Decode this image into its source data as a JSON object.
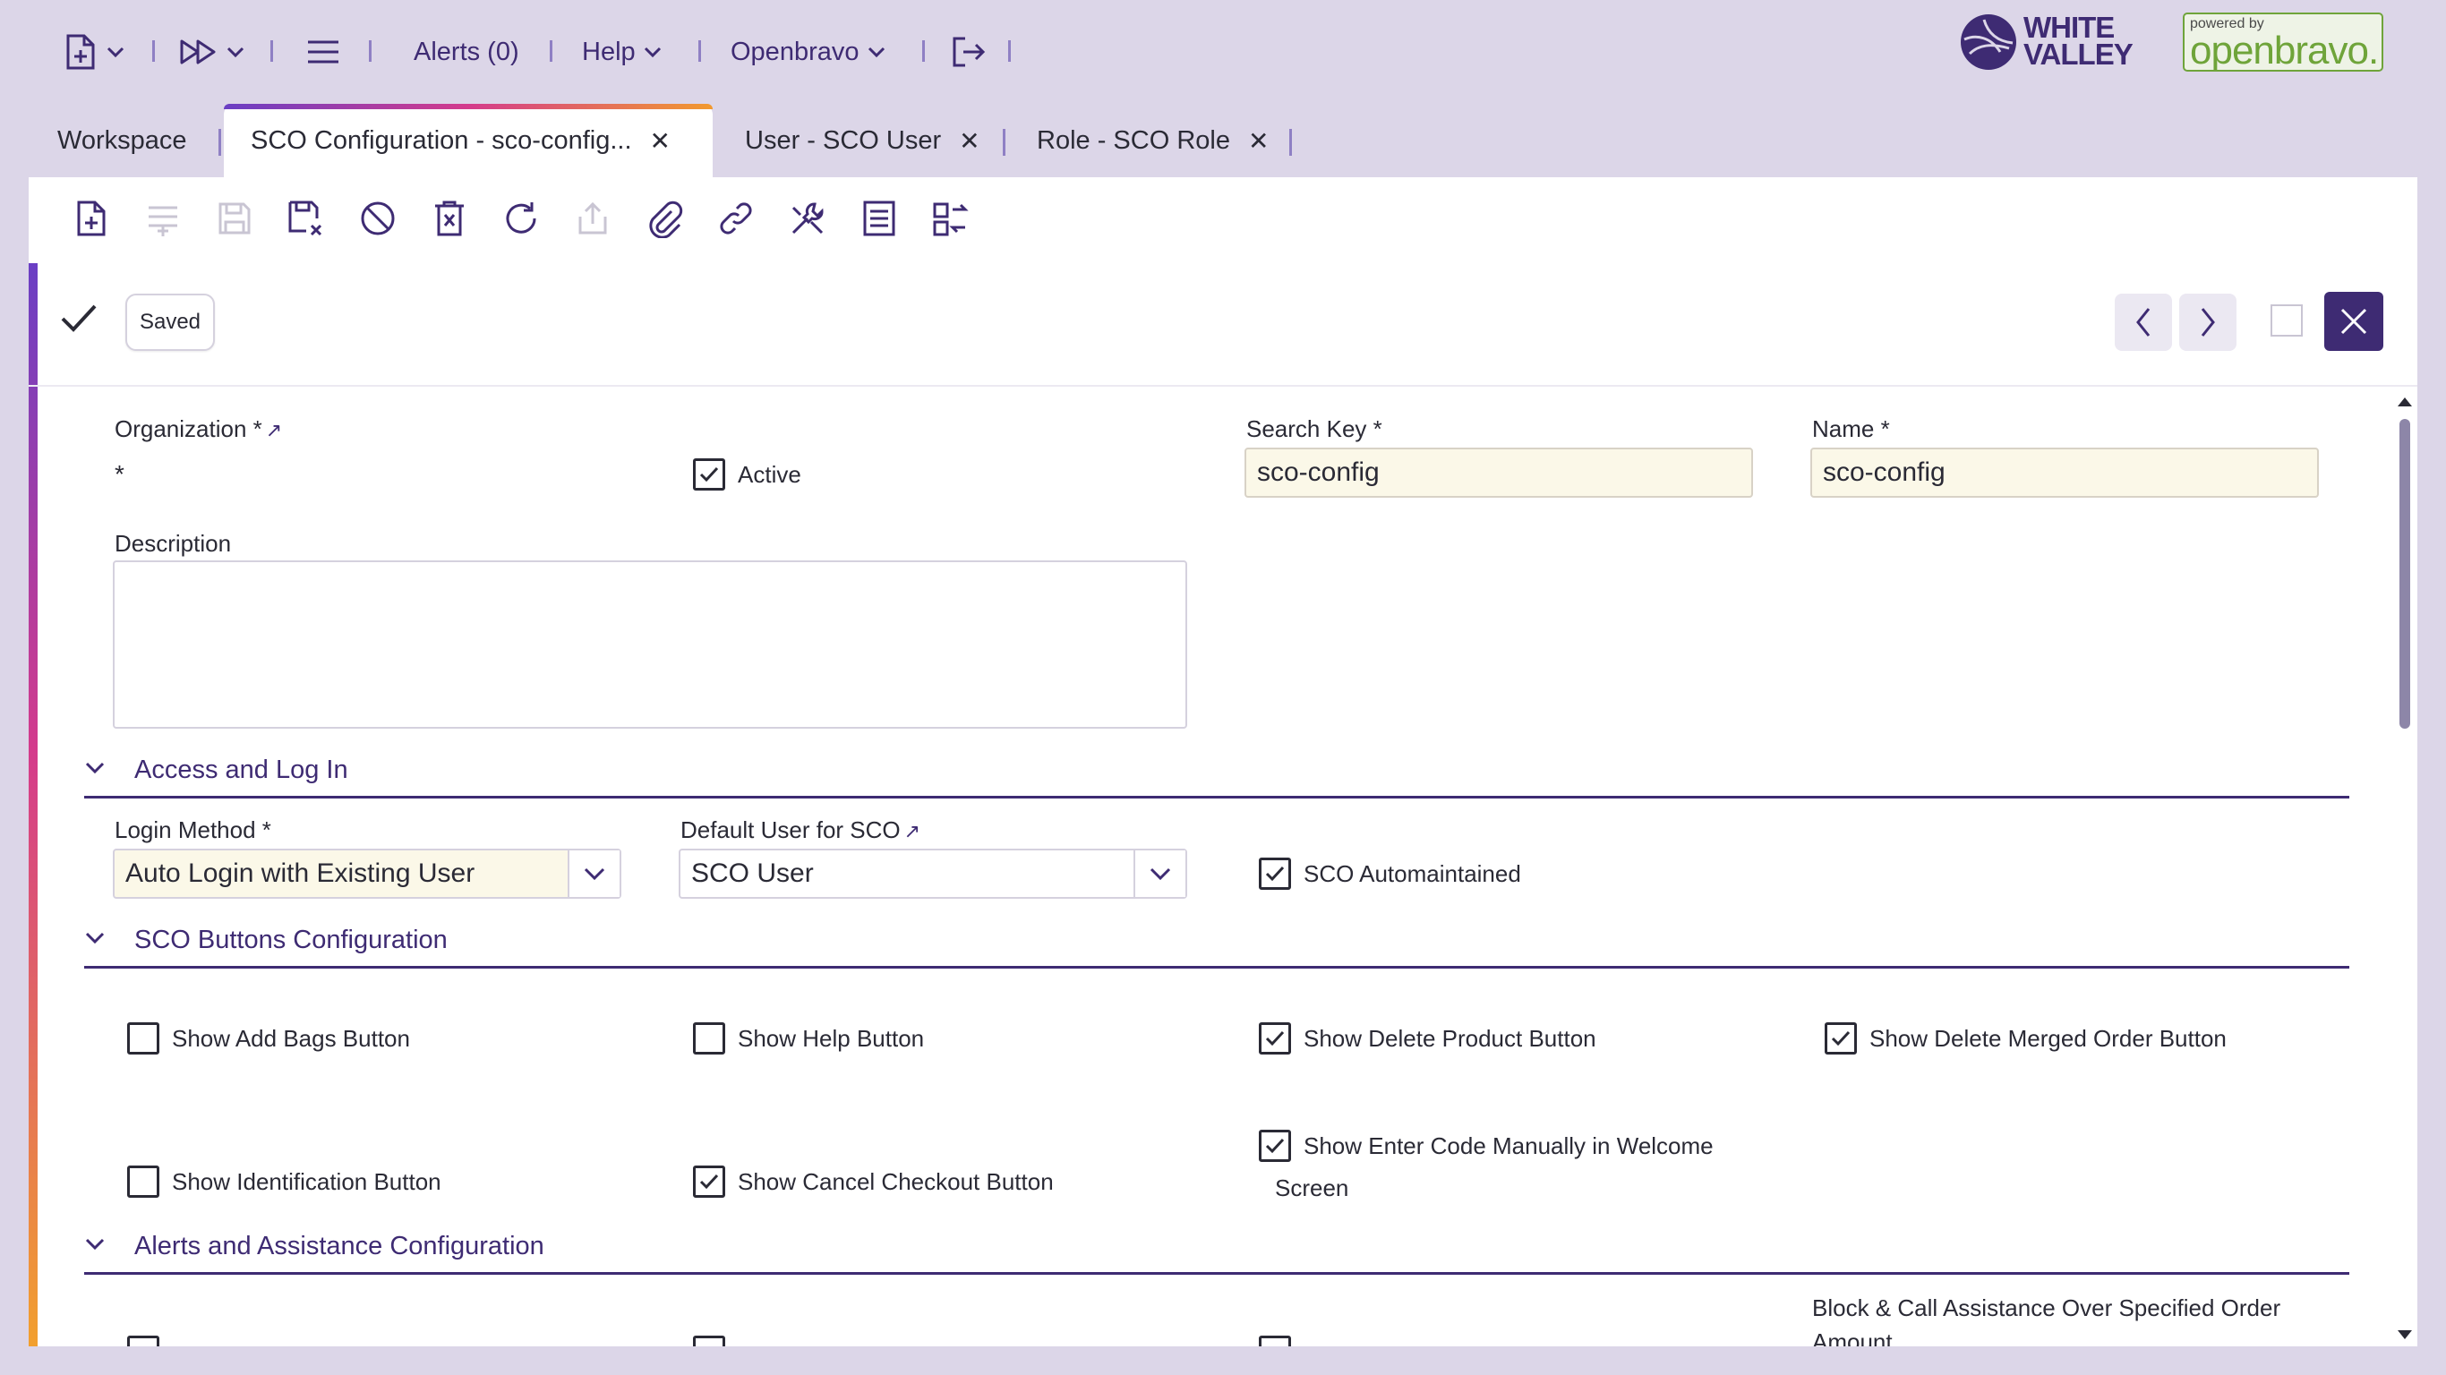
{
  "nav": {
    "alerts_label": "Alerts (0)",
    "help_label": "Help",
    "user_label": "Openbravo"
  },
  "brand": {
    "wv_line1": "WHITE",
    "wv_line2": "VALLEY",
    "ob_small": "powered by",
    "ob_big": "openbravo."
  },
  "tabs": [
    {
      "label": "Workspace"
    },
    {
      "label": "SCO Configuration - sco-config..."
    },
    {
      "label": "User - SCO User"
    },
    {
      "label": "Role - SCO Role"
    }
  ],
  "status": {
    "saved_label": "Saved"
  },
  "form": {
    "organization_label": "Organization *",
    "organization_value": "*",
    "active_label": "Active",
    "search_key_label": "Search Key *",
    "search_key_value": "sco-config",
    "name_label": "Name *",
    "name_value": "sco-config",
    "description_label": "Description"
  },
  "sections": {
    "access": "Access and Log In",
    "buttons": "SCO Buttons Configuration",
    "alerts": "Alerts and Assistance Configuration"
  },
  "access": {
    "login_method_label": "Login Method *",
    "login_method_value": "Auto Login with Existing User",
    "default_user_label": "Default User for SCO",
    "default_user_value": "SCO User",
    "automaintained_label": "SCO Automaintained"
  },
  "buttons": {
    "add_bags": "Show Add Bags Button",
    "help": "Show Help Button",
    "delete_product": "Show Delete Product Button",
    "delete_merged": "Show Delete Merged Order Button",
    "identification": "Show Identification Button",
    "cancel_checkout": "Show Cancel Checkout Button",
    "enter_code_1": "Show Enter Code Manually in Welcome",
    "enter_code_2": "Screen"
  },
  "alerts": {
    "block_call_1": "Block & Call Assistance Over Specified Order",
    "block_call_2": "Amount"
  },
  "colors": {
    "brand": "#3e2b73",
    "accent_bg": "#dcd6e8",
    "required_field": "#fbf8e8"
  }
}
